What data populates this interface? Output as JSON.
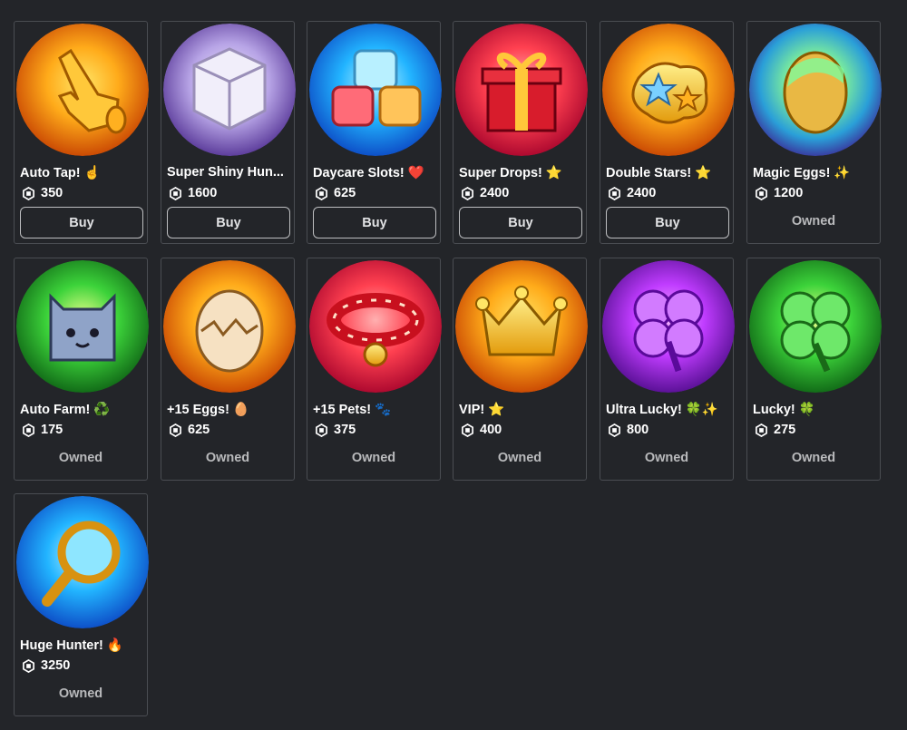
{
  "colors": {
    "background": "#232529",
    "card_border": "#4a4d52",
    "text": "#ffffff",
    "owned_text": "#b9babc"
  },
  "gamepasses": [
    {
      "name": "Auto Tap! ☝️",
      "price": "350",
      "status": "Buy",
      "icon": "tap-hand-icon"
    },
    {
      "name": "Super Shiny Hun...",
      "price": "1600",
      "status": "Buy",
      "icon": "shiny-cube-icon"
    },
    {
      "name": "Daycare Slots! ❤️",
      "price": "625",
      "status": "Buy",
      "icon": "daycare-cubes-icon"
    },
    {
      "name": "Super Drops! ⭐",
      "price": "2400",
      "status": "Buy",
      "icon": "gift-box-icon"
    },
    {
      "name": "Double Stars! ⭐",
      "price": "2400",
      "status": "Buy",
      "icon": "double-stars-icon"
    },
    {
      "name": "Magic Eggs! ✨",
      "price": "1200",
      "status": "Owned",
      "icon": "magic-egg-icon"
    },
    {
      "name": "Auto Farm! ♻️",
      "price": "175",
      "status": "Owned",
      "icon": "cat-pet-icon"
    },
    {
      "name": "+15 Eggs! 🥚",
      "price": "625",
      "status": "Owned",
      "icon": "cracked-egg-icon"
    },
    {
      "name": "+15 Pets! 🐾",
      "price": "375",
      "status": "Owned",
      "icon": "pet-collar-icon"
    },
    {
      "name": "VIP! ⭐",
      "price": "400",
      "status": "Owned",
      "icon": "vip-crown-icon"
    },
    {
      "name": "Ultra Lucky! 🍀✨",
      "price": "800",
      "status": "Owned",
      "icon": "purple-clover-icon"
    },
    {
      "name": "Lucky! 🍀",
      "price": "275",
      "status": "Owned",
      "icon": "green-clover-icon"
    },
    {
      "name": "Huge Hunter! 🔥",
      "price": "3250",
      "status": "Owned",
      "icon": "magnifier-icon"
    }
  ]
}
